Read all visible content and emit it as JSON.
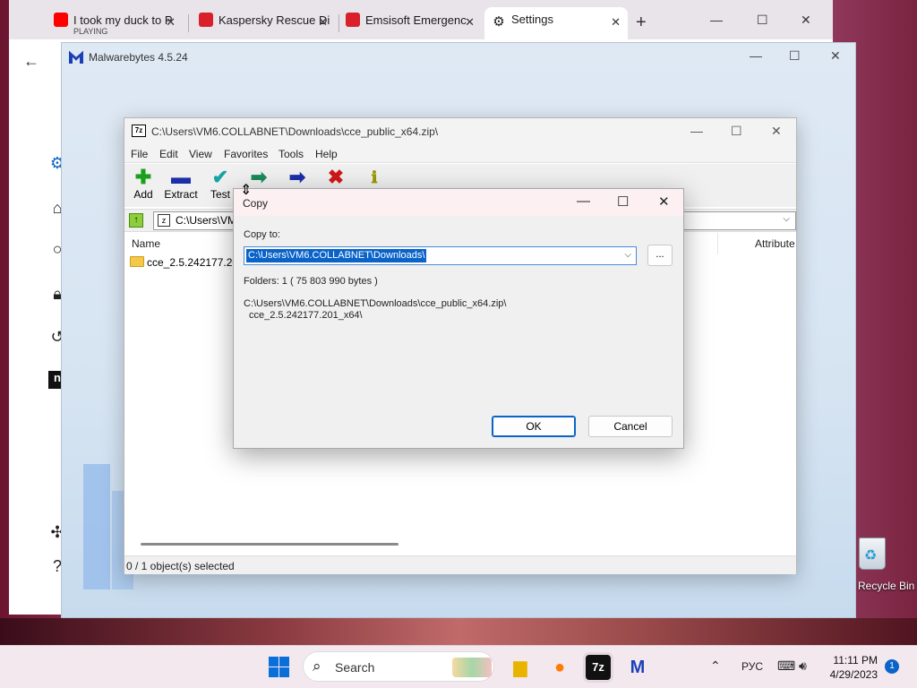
{
  "browser": {
    "tabs": [
      {
        "label": "I took my duck to P",
        "sub": "PLAYING",
        "icon": "youtube-icon"
      },
      {
        "label": "Kaspersky Rescue Di",
        "icon": "kaspersky-icon"
      },
      {
        "label": "Emsisoft Emergenc",
        "icon": "emsisoft-icon"
      },
      {
        "label": "Settings",
        "icon": "gear-icon"
      }
    ],
    "new_tab": "+"
  },
  "malwarebytes": {
    "title": "Malwarebytes 4.5.24"
  },
  "sevenzip": {
    "title": "C:\\Users\\VM6.COLLABNET\\Downloads\\cce_public_x64.zip\\",
    "icon_text": "7z",
    "menu": [
      "File",
      "Edit",
      "View",
      "Favorites",
      "Tools",
      "Help"
    ],
    "toolbar": [
      "Add",
      "Extract",
      "Test"
    ],
    "address": "C:\\Users\\VM",
    "columns": {
      "name": "Name",
      "attributes": "Attribute"
    },
    "rows": [
      {
        "name": "cce_2.5.242177.201"
      }
    ],
    "status": "0 / 1 object(s) selected"
  },
  "copy_dialog": {
    "title": "Copy",
    "copy_to_label": "Copy to:",
    "copy_to_value": "C:\\Users\\VM6.COLLABNET\\Downloads\\",
    "browse_label": "...",
    "info": "Folders: 1    ( 75 803 990 bytes )",
    "source_line1": "C:\\Users\\VM6.COLLABNET\\Downloads\\cce_public_x64.zip\\",
    "source_line2": "cce_2.5.242177.201_x64\\",
    "ok_label": "OK",
    "cancel_label": "Cancel"
  },
  "desktop": {
    "recycle_bin_label": "Recycle Bin"
  },
  "taskbar": {
    "search_label": "Search",
    "language": "РУС",
    "time": "11:11 PM",
    "date": "4/29/2023",
    "notifications": "1",
    "sevenzip_icon_text": "7z"
  }
}
